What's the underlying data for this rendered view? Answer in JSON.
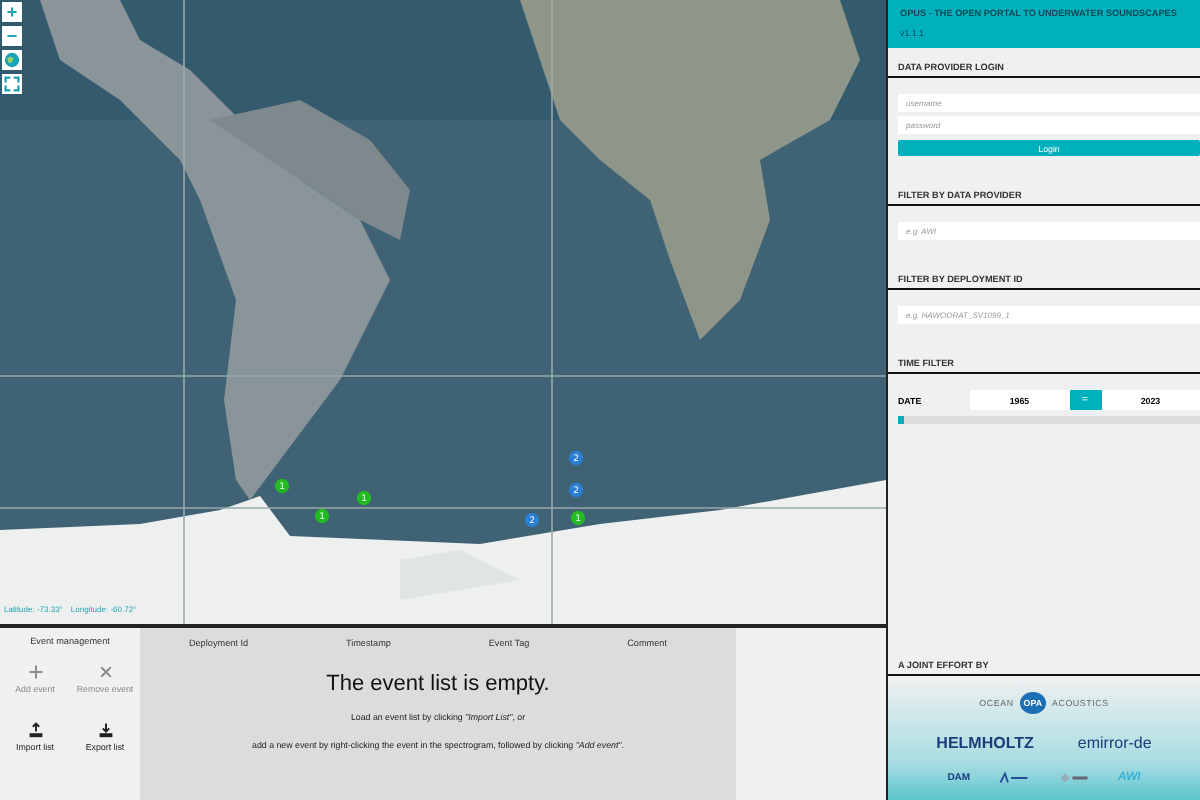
{
  "map": {
    "zoom_controls": [
      "+",
      "−"
    ],
    "markers": [
      {
        "label": "1",
        "color": "#22bb22"
      },
      {
        "label": "1",
        "color": "#22bb22"
      },
      {
        "label": "1",
        "color": "#22bb22"
      },
      {
        "label": "2",
        "color": "#2a7fd4"
      },
      {
        "label": "2",
        "color": "#2a7fd4"
      },
      {
        "label": "2",
        "color": "#2a7fd4"
      },
      {
        "label": "1",
        "color": "#22bb22"
      }
    ],
    "latitude": "Latitude: -73.33°",
    "longitude": "Longitude: -60.72°"
  },
  "event_management": {
    "title": "Event management",
    "buttons": [
      {
        "label": "Add event",
        "kind": "add",
        "disabled": true
      },
      {
        "label": "Remove event",
        "kind": "remove",
        "disabled": true
      },
      {
        "label": "Import list",
        "kind": "import",
        "disabled": false
      },
      {
        "label": "Export list",
        "kind": "export",
        "disabled": false
      }
    ]
  },
  "event_table": {
    "columns": [
      "Deployment Id",
      "Timestamp",
      "Event Tag",
      "Comment"
    ],
    "empty_title": "The event list is empty.",
    "empty_lines": [
      "Load an event list by clicking *\"Import List\"*, or",
      "add a new event by right-clicking the event in the spectrogram, followed by clicking *\"Add event\"*."
    ]
  },
  "sidebar": {
    "title": "OPUS - THE OPEN PORTAL TO UNDERWATER SOUNDSCAPES",
    "version": "v1.1.1",
    "login": {
      "heading": "DATA PROVIDER LOGIN",
      "username_placeholder": "username",
      "password_placeholder": "password",
      "button": "Login"
    },
    "provider_filter": {
      "heading": "FILTER BY DATA PROVIDER",
      "placeholder": "e.g. AWI"
    },
    "deployment_filter": {
      "heading": "FILTER BY DEPLOYMENT ID",
      "placeholder": "e.g. HAWOORAT_SV1099_1"
    },
    "time_filter": {
      "heading": "TIME FILTER",
      "label": "DATE",
      "from": "1965",
      "operator": "=",
      "to": "2023",
      "level": 0.02
    },
    "partners": {
      "heading": "A JOINT EFFORT BY",
      "logos": [
        "OCEAN",
        "OPA",
        "ACOUSTICS",
        "HELMHOLTZ",
        "emirror-de",
        "DAM",
        "AWI"
      ]
    }
  }
}
